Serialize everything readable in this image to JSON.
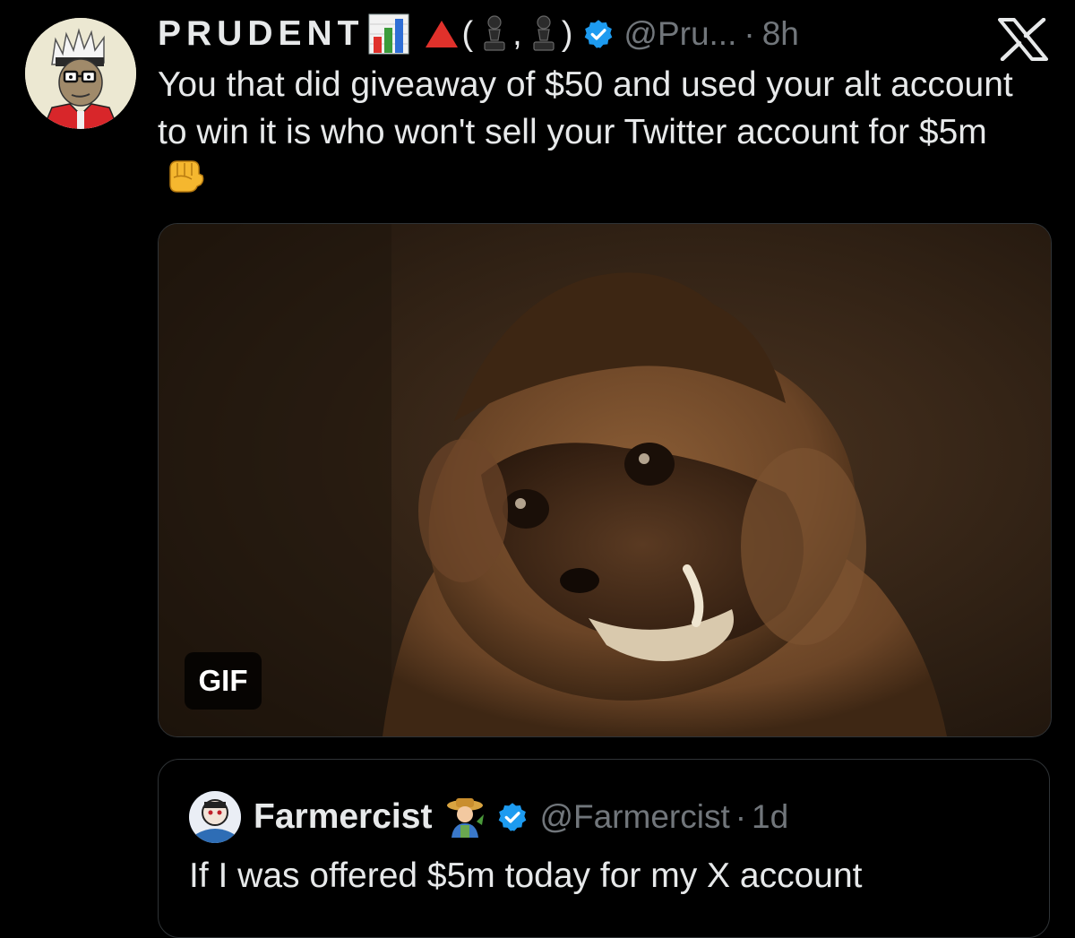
{
  "tweet": {
    "display_name": "PRUDENT",
    "name_decorations": [
      "chart-emoji",
      "red-triangle-emoji",
      "pawn-emoji",
      "pawn-emoji"
    ],
    "paren_open": "(",
    "comma": ",",
    "paren_close": ")",
    "handle": "@Pru...",
    "separator": "·",
    "timestamp": "8h",
    "text": "You that did giveaway of $50 and used your alt account to win it is who won't sell your Twitter account for $5m",
    "trailing_emoji": "oncoming-fist-emoji",
    "verified": true,
    "media": {
      "type": "GIF",
      "badge_label": "GIF",
      "description_icon": "grinning-monkey-gif"
    }
  },
  "platform_logo": "x-logo-icon",
  "quoted_tweet": {
    "display_name": "Farmercist",
    "name_emoji": "farmer-emoji",
    "verified": true,
    "handle": "@Farmercist",
    "separator": "·",
    "timestamp": "1d",
    "text": "If I was offered $5m today for my X account"
  },
  "colors": {
    "background": "#000000",
    "text_primary": "#e7e9ea",
    "text_secondary": "#71767b",
    "verified_blue": "#1d9bf0",
    "border": "#2f3336"
  }
}
